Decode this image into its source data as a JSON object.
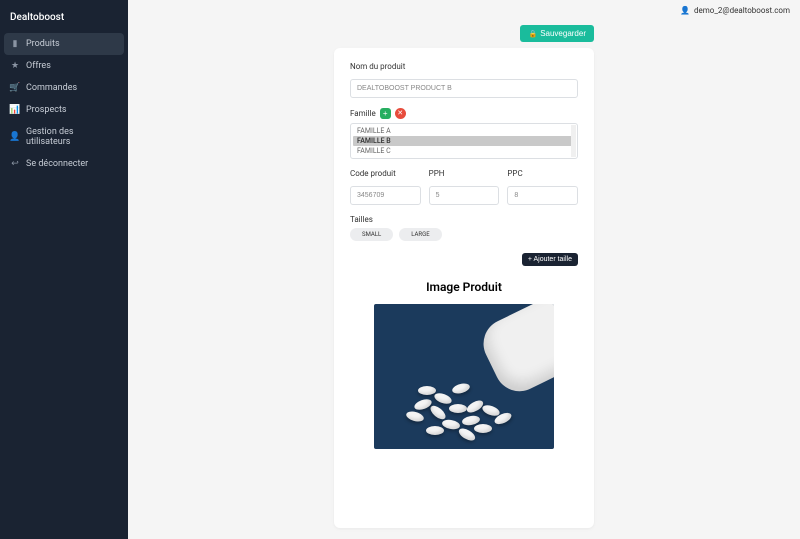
{
  "brand": "Dealtoboost",
  "sidebar": {
    "items": [
      {
        "label": "Produits",
        "icon": "▮",
        "active": true
      },
      {
        "label": "Offres",
        "icon": "★"
      },
      {
        "label": "Commandes",
        "icon": "🛒"
      },
      {
        "label": "Prospects",
        "icon": "📊"
      },
      {
        "label": "Gestion des utilisateurs",
        "icon": "👤"
      },
      {
        "label": "Se déconnecter",
        "icon": "↩"
      }
    ]
  },
  "topbar": {
    "user_email": "demo_2@dealtoboost.com"
  },
  "actions": {
    "save_label": "Sauvegarder"
  },
  "form": {
    "name_label": "Nom du produit",
    "name_value": "DEALTOBOOST PRODUCT B",
    "famille_label": "Famille",
    "famille_options": [
      "FAMILLE A",
      "FAMILLE B",
      "FAMILLE C"
    ],
    "famille_selected": "FAMILLE B",
    "code_label": "Code produit",
    "code_value": "3456709",
    "pph_label": "PPH",
    "pph_value": "5",
    "ppc_label": "PPC",
    "ppc_value": "8",
    "tailles_label": "Tailles",
    "sizes": [
      "SMALL",
      "LARGE"
    ],
    "add_size_label": "+ Ajouter taille",
    "image_title": "Image Produit"
  }
}
